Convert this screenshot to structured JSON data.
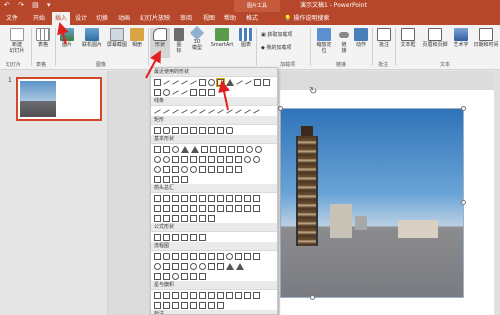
{
  "titlebar": {
    "qat": "↶ ↷ ▤ ▾",
    "context_tab": "图片工具",
    "doc_title": "演示文稿1 - PowerPoint"
  },
  "tabs": [
    {
      "label": "文件",
      "active": false
    },
    {
      "label": "开始",
      "active": false
    },
    {
      "label": "插入",
      "active": true
    },
    {
      "label": "设计",
      "active": false
    },
    {
      "label": "切换",
      "active": false
    },
    {
      "label": "动画",
      "active": false
    },
    {
      "label": "幻灯片放映",
      "active": false
    },
    {
      "label": "审阅",
      "active": false
    },
    {
      "label": "视图",
      "active": false
    },
    {
      "label": "帮助",
      "active": false
    },
    {
      "label": "格式",
      "active": false
    }
  ],
  "tellme": "操作说明搜索",
  "ribbon": {
    "new_slide": "新建\n幻灯片",
    "table": "表格",
    "picture": "图片",
    "online_picture": "联机图片",
    "screenshot": "屏幕截图",
    "album": "相册",
    "shapes": "形状",
    "icons": "图\n标",
    "models_3d": "3D\n模型",
    "smartart": "SmartArt",
    "chart": "图表",
    "get_addins": "获取加载项",
    "my_addins": "我的加载项",
    "zoom": "缩放定\n位",
    "link": "链\n接",
    "action": "动作",
    "comment": "批注",
    "textbox": "文本框",
    "header_footer": "页眉和页脚",
    "wordart": "艺术字",
    "datetime": "日期和时间",
    "groups": {
      "slides": "幻灯片",
      "tables": "表格",
      "images": "图像",
      "addins": "加载项",
      "links": "链接",
      "comments": "批注",
      "text": "文本"
    }
  },
  "slide_panel": {
    "slide_number": "1"
  },
  "shapes_menu": {
    "sections": [
      "最近使用的形状",
      "线条",
      "矩形",
      "基本形状",
      "箭头总汇",
      "公式形状",
      "流程图",
      "星与旗帜",
      "标注"
    ]
  },
  "colors": {
    "accent": "#b7472a",
    "arrow": "#e32020"
  }
}
